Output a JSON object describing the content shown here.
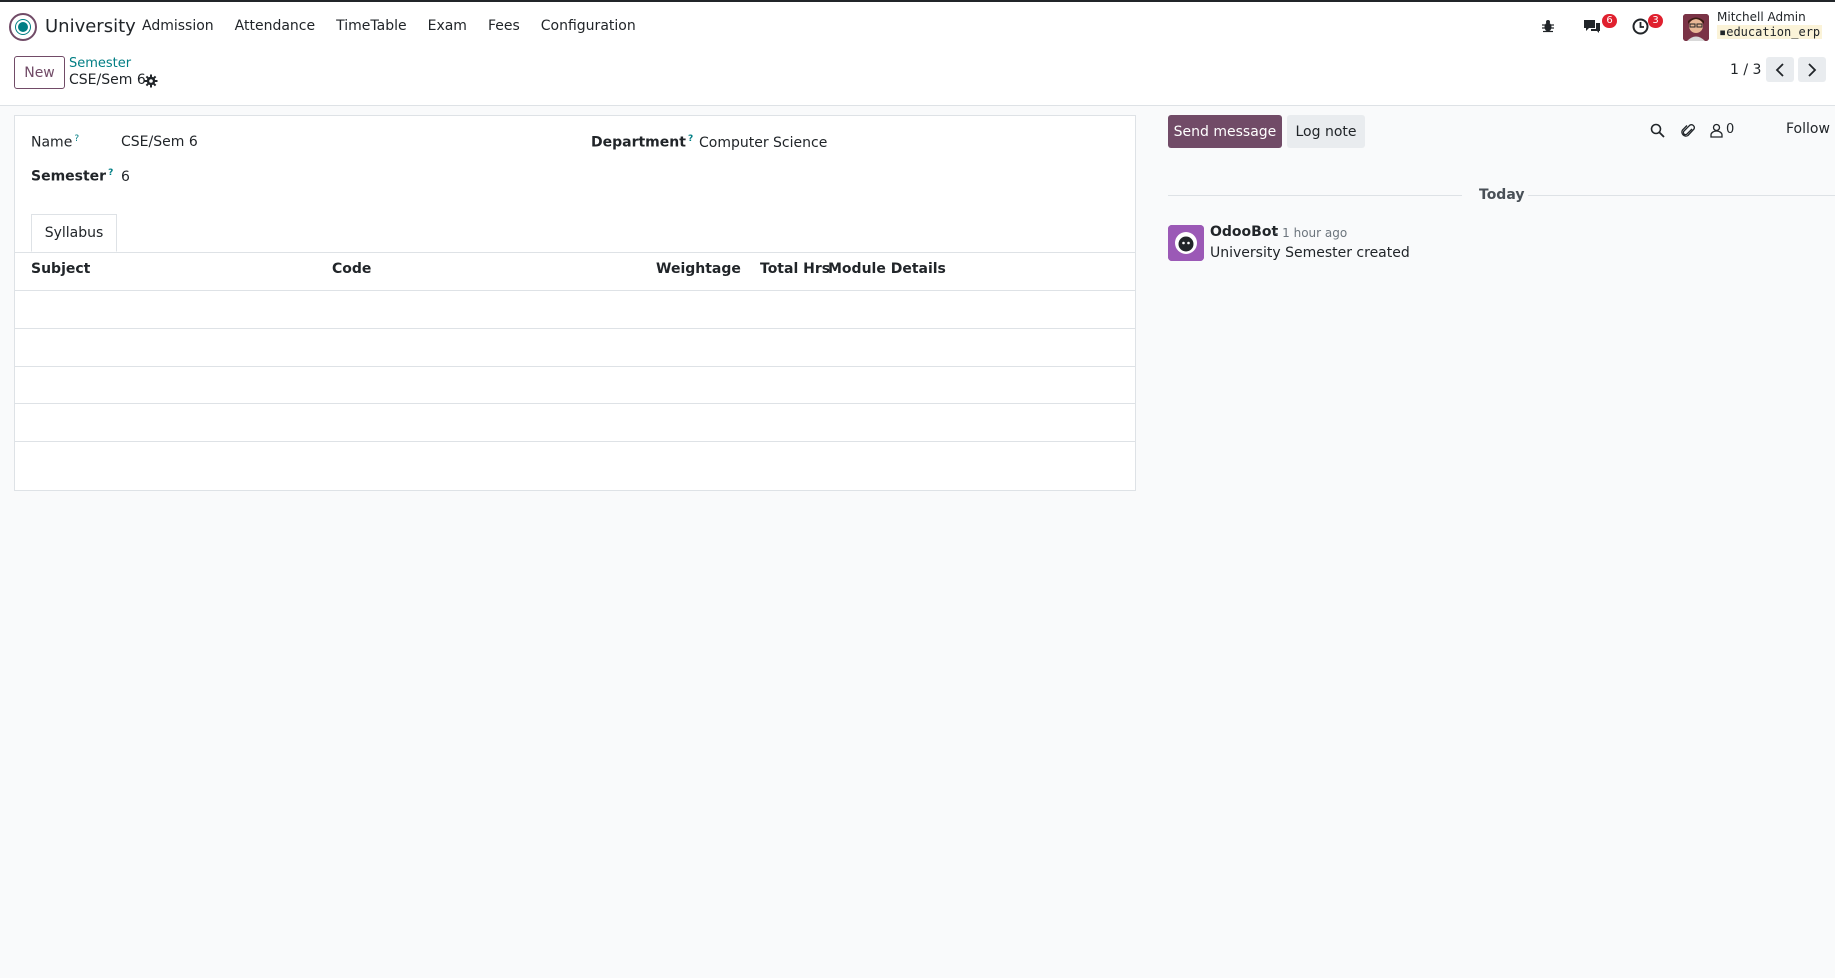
{
  "navbar": {
    "app_name": "University",
    "menu": [
      "Admission",
      "Attendance",
      "TimeTable",
      "Exam",
      "Fees",
      "Configuration"
    ],
    "messages_badge": "6",
    "activities_badge": "3",
    "user_name": "Mitchell Admin",
    "database": "education_erp"
  },
  "control_panel": {
    "new_label": "New",
    "breadcrumb_parent": "Semester",
    "breadcrumb_current": "CSE/Sem 6",
    "pager": "1 / 3"
  },
  "form": {
    "name_label": "Name",
    "name_value": "CSE/Sem 6",
    "department_label": "Department",
    "department_value": "Computer Science",
    "semester_label": "Semester",
    "semester_value": "6",
    "help_mark": "?",
    "tab_label": "Syllabus",
    "columns": [
      "Subject",
      "Code",
      "Weightage",
      "Total Hrs",
      "Module Details"
    ]
  },
  "chatter": {
    "send_message_label": "Send message",
    "log_note_label": "Log note",
    "followers_count": "0",
    "follow_label": "Follow",
    "date_separator": "Today",
    "message": {
      "author": "OdooBot",
      "time": "- 1 hour ago",
      "body": "University Semester created"
    }
  },
  "colors": {
    "primary": "#714b67",
    "accent": "#017e84",
    "badge": "#e0202e"
  }
}
